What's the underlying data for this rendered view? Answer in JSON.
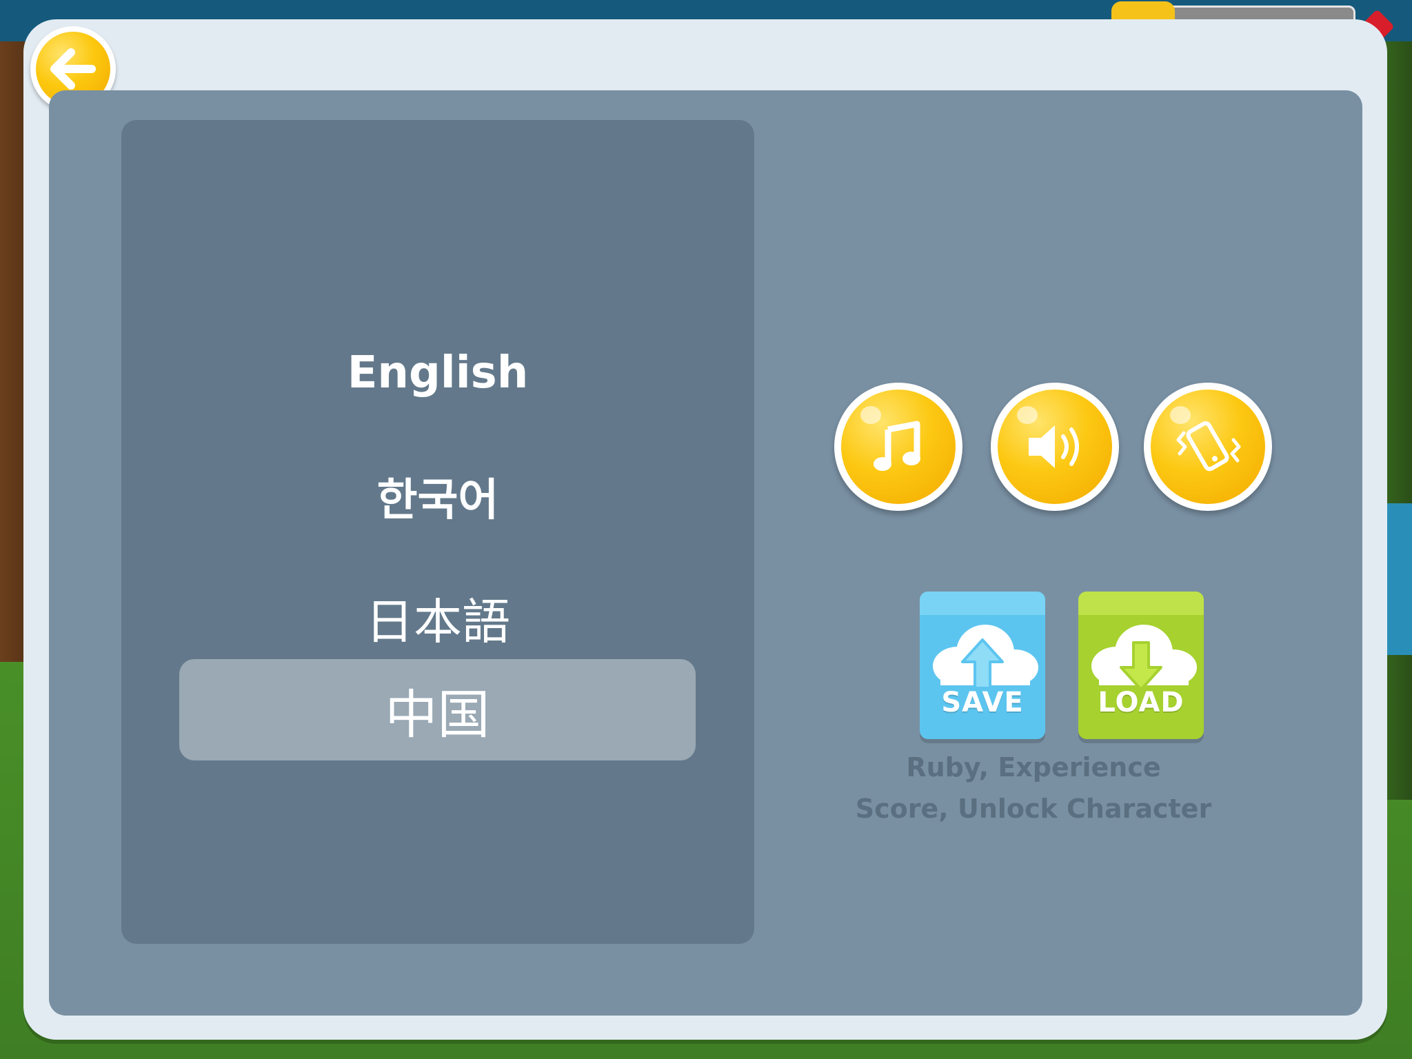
{
  "settings": {
    "languages": {
      "english": "English",
      "korean": "한국어",
      "japanese": "日本語",
      "chinese": "中国",
      "selected": "中国"
    },
    "toggles": [
      {
        "name": "music",
        "icon": "music-note-icon"
      },
      {
        "name": "sound",
        "icon": "speaker-icon"
      },
      {
        "name": "vibration",
        "icon": "vibrate-phone-icon"
      }
    ],
    "cloud": {
      "save_label": "SAVE",
      "load_label": "LOAD",
      "note_line1": "Ruby, Experience",
      "note_line2": "Score, Unlock Character"
    },
    "back_icon": "back-arrow-icon"
  },
  "colors": {
    "modal_bg": "#e2ebf2",
    "panel_bg": "#7990a3",
    "lang_panel_bg": "#63798b",
    "selected_row": "#9aa9b4",
    "coin_yellow": "#fcc812",
    "save_blue": "#5cc5ef",
    "load_green": "#a6d12f"
  }
}
